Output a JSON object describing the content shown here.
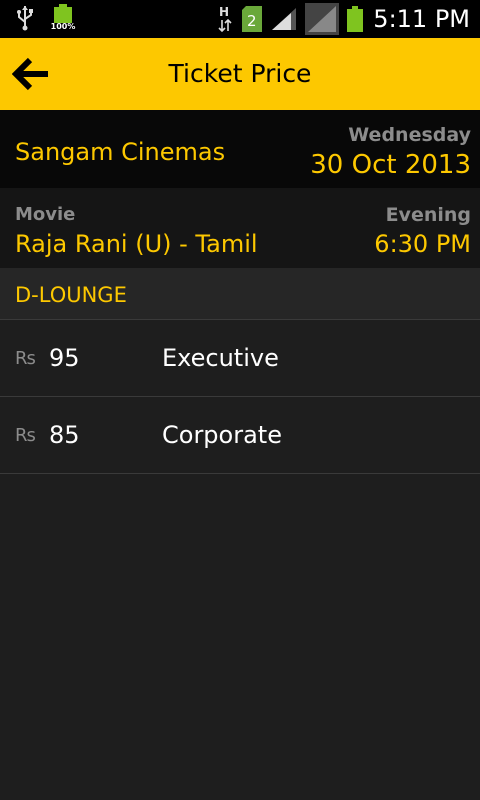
{
  "status_bar": {
    "battery_small_label": "100%",
    "network_type": "H",
    "sim_slot": "2",
    "time": "5:11 PM",
    "icons": [
      "usb-icon",
      "battery-icon",
      "h-network-icon",
      "sim-icon",
      "signal-icon",
      "signal-icon",
      "battery-icon"
    ]
  },
  "app_bar": {
    "title": "Ticket Price",
    "back_icon": "back-arrow-icon"
  },
  "cinema": {
    "name": "Sangam Cinemas",
    "weekday": "Wednesday",
    "date": "30 Oct 2013"
  },
  "movie": {
    "label": "Movie",
    "name": "Raja Rani (U) - Tamil",
    "show_label": "Evening",
    "show_time": "6:30 PM"
  },
  "seating": {
    "class_name": "D-LOUNGE",
    "prices": [
      {
        "currency": "Rs",
        "amount": "95",
        "tier": "Executive"
      },
      {
        "currency": "Rs",
        "amount": "85",
        "tier": "Corporate"
      }
    ]
  },
  "colors": {
    "accent": "#fdc800",
    "background": "#1e1e1e",
    "muted_text": "#8c8c8c"
  }
}
